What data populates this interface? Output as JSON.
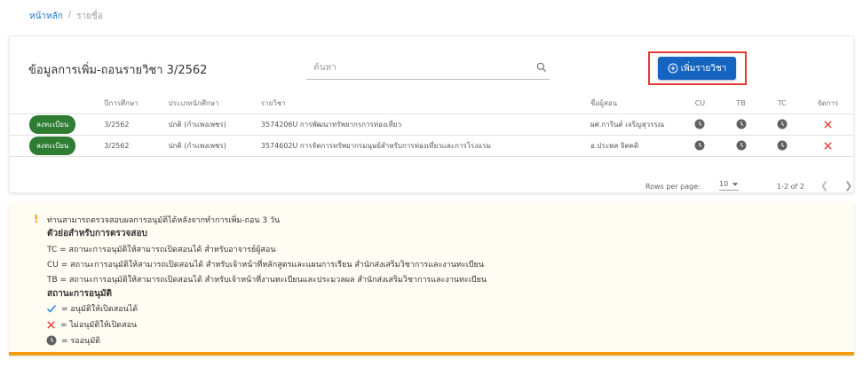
{
  "breadcrumb": {
    "home": "หน้าหลัก",
    "separator": "/",
    "current": "รายชื่อ"
  },
  "card": {
    "title": "ข้อมูลการเพิ่ม-ถอนรายวิชา 3/2562",
    "search_placeholder": "ค้นหา",
    "add_button_label": "เพิ่มรายวิชา"
  },
  "table": {
    "headers": {
      "status": "",
      "year": "ปีการศึกษา",
      "type": "ประเภทนักศึกษา",
      "course": "รายวิชา",
      "teacher": "ชื่อผู้สอน",
      "cu": "CU",
      "tb": "TB",
      "tc": "TC",
      "actions": "จัดการ"
    },
    "rows": [
      {
        "status": "ลงทะเบียน",
        "year": "3/2562",
        "type": "ปกติ (กำแพงเพชร)",
        "course": "3574206U การพัฒนาทรัพยากรการท่องเที่ยว",
        "teacher": "ผศ.การินต์ เจริญสุวรรณ",
        "cu": "pending",
        "tb": "pending",
        "tc": "pending"
      },
      {
        "status": "ลงทะเบียน",
        "year": "3/2562",
        "type": "ปกติ (กำแพงเพชร)",
        "course": "3574602U การจัดการทรัพยากรมนุษย์สำหรับการท่องเที่ยวและการโรงแรม",
        "teacher": "อ.ประพล จิตคติ",
        "cu": "pending",
        "tb": "pending",
        "tc": "pending"
      }
    ],
    "footer": {
      "rows_per_page_label": "Rows per page:",
      "rows_per_page_value": "10",
      "range": "1-2 of 2"
    }
  },
  "notice": {
    "warning": "!",
    "message": "ท่านสามารถตรวจสอบผลการอนุมัติได้หลังจากทำการเพิ่ม-ถอน 3 วัน",
    "abbrev_heading": "ตัวย่อสำหรับการตรวจสอบ",
    "tc": "TC = สถานะการอนุมัติให้สามารถเปิดสอนได้ สำหรับอาจารย์ผู้สอน",
    "cu": "CU = สถานะการอนุมัติให้สามารถเปิดสอนได้ สำหรับเจ้าหน้าที่หลักสูตรและแผนการเรียน สำนักส่งเสริมวิชาการและงานทะเบียน",
    "tb": "TB = สถานะการอนุมัติให้สามารถเปิดสอนได้ สำหรับเจ้าหน้าที่งานทะเบียนและประมวลผล สำนักส่งเสริมวิชาการและงานทะเบียน",
    "status_heading": "สถานะการอนุมัติ",
    "approved": "= อนุมัติให้เปิดสอนได้",
    "rejected": "= ไม่อนุมัติให้เปิดสอน",
    "pending": "= รออนุมัติ"
  },
  "colors": {
    "primary": "#1565c0",
    "badge": "#2e7d32",
    "delete": "#e53935",
    "highlight": "#e53935",
    "warning": "#f39c12",
    "approved": "#1e88e5",
    "pending": "#616161"
  }
}
